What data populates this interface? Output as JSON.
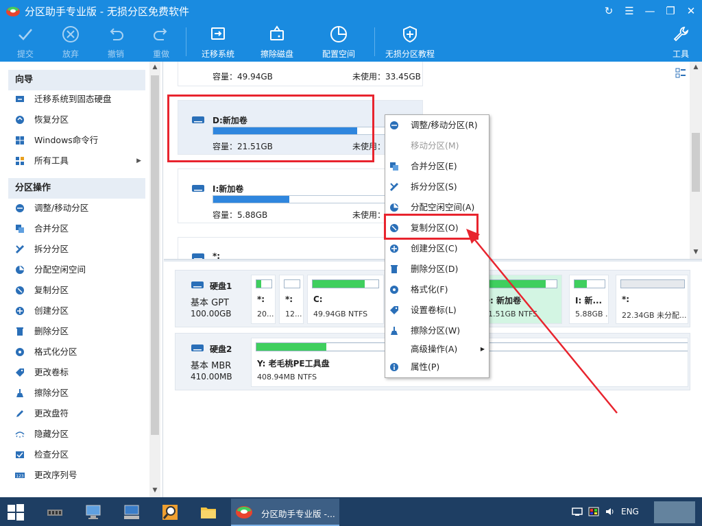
{
  "window": {
    "title": "分区助手专业版 - 无损分区免费软件"
  },
  "toolbar": {
    "commit": "提交",
    "discard": "放弃",
    "undo": "撤销",
    "redo": "重做",
    "migrate_os": "迁移系统",
    "wipe_disk": "擦除磁盘",
    "allocate_space": "配置空间",
    "tutorial": "无损分区教程",
    "tools": "工具"
  },
  "sidebar": {
    "wizard_header": "向导",
    "wizard_items": [
      {
        "label": "迁移系统到固态硬盘",
        "icon": "migrate-os-icon"
      },
      {
        "label": "恢复分区",
        "icon": "restore-icon"
      },
      {
        "label": "Windows命令行",
        "icon": "windows-icon"
      },
      {
        "label": "所有工具",
        "icon": "tools-grid-icon"
      }
    ],
    "ops_header": "分区操作",
    "ops_items": [
      {
        "label": "调整/移动分区",
        "icon": "resize-icon"
      },
      {
        "label": "合并分区",
        "icon": "merge-icon"
      },
      {
        "label": "拆分分区",
        "icon": "split-icon"
      },
      {
        "label": "分配空闲空间",
        "icon": "allocate-icon"
      },
      {
        "label": "复制分区",
        "icon": "copy-partition-icon"
      },
      {
        "label": "创建分区",
        "icon": "create-icon"
      },
      {
        "label": "删除分区",
        "icon": "delete-icon"
      },
      {
        "label": "格式化分区",
        "icon": "format-icon"
      },
      {
        "label": "更改卷标",
        "icon": "label-tag-icon"
      },
      {
        "label": "擦除分区",
        "icon": "wipe-icon"
      },
      {
        "label": "更改盘符",
        "icon": "pencil-icon"
      },
      {
        "label": "隐藏分区",
        "icon": "eye-hidden-icon"
      },
      {
        "label": "检查分区",
        "icon": "check-icon"
      },
      {
        "label": "更改序列号",
        "icon": "serial-123-icon"
      }
    ]
  },
  "partitions_view": {
    "top_partial": {
      "capacity": "容量：49.94GB",
      "unused": "未使用：33.45GB"
    },
    "cards": [
      {
        "name": "D:新加卷",
        "capacity": "容量：21.51GB",
        "unused": "未使用：",
        "fill": 0.7
      },
      {
        "name": "I:新加卷",
        "capacity": "容量：5.88GB",
        "unused": "未使用：5",
        "fill": 0.37
      },
      {
        "name": "*:"
      }
    ]
  },
  "disks": [
    {
      "name": "硬盘1",
      "type": "基本 GPT",
      "size": "100.00GB",
      "partitions": [
        {
          "label": "*:",
          "info": "20...",
          "fill": 0.3
        },
        {
          "label": "*:",
          "info": "12...",
          "fill": 0.0
        },
        {
          "label": "C:",
          "info": "49.94GB NTFS",
          "fill": 0.55
        },
        {
          "label": "D: 新加卷",
          "info": "21.51GB NTFS",
          "fill": 0.85,
          "selected": true
        },
        {
          "label": "I: 新...",
          "info": "5.88GB ...",
          "fill": 0.4
        },
        {
          "label": "*:",
          "info": "22.34GB 未分配...",
          "fill": 0.0,
          "unallocated": true
        }
      ]
    },
    {
      "name": "硬盘2",
      "type": "基本 MBR",
      "size": "410.00MB",
      "partitions": [
        {
          "label": "Y: 老毛桃PE工具盘",
          "info": "408.94MB NTFS",
          "fill": 0.16
        }
      ]
    }
  ],
  "context_menu": {
    "items": [
      {
        "label": "调整/移动分区(R)",
        "icon": "resize-icon"
      },
      {
        "label": "移动分区(M)",
        "icon": "",
        "disabled": true
      },
      {
        "label": "合并分区(E)",
        "icon": "merge-icon"
      },
      {
        "label": "拆分分区(S)",
        "icon": "split-icon"
      },
      {
        "label": "分配空闲空间(A)",
        "icon": "allocate-icon"
      },
      {
        "label": "复制分区(O)",
        "icon": "copy-partition-icon"
      },
      {
        "label": "创建分区(C)",
        "icon": "create-icon"
      },
      {
        "label": "删除分区(D)",
        "icon": "delete-icon"
      },
      {
        "label": "格式化(F)",
        "icon": "format-icon"
      },
      {
        "label": "设置卷标(L)",
        "icon": "label-tag-icon"
      },
      {
        "label": "擦除分区(W)",
        "icon": "wipe-icon"
      },
      {
        "label": "高级操作(A)",
        "icon": "",
        "submenu": true
      },
      {
        "label": "属性(P)",
        "icon": "info-icon"
      }
    ]
  },
  "taskbar": {
    "active_app": "分区助手专业版 -...",
    "language": "ENG"
  },
  "colors": {
    "accent": "#1a8be0",
    "highlight_red": "#e8242e",
    "used_blue": "#2f86de",
    "used_green": "#3fcf5e",
    "taskbar": "#1e3e63"
  }
}
